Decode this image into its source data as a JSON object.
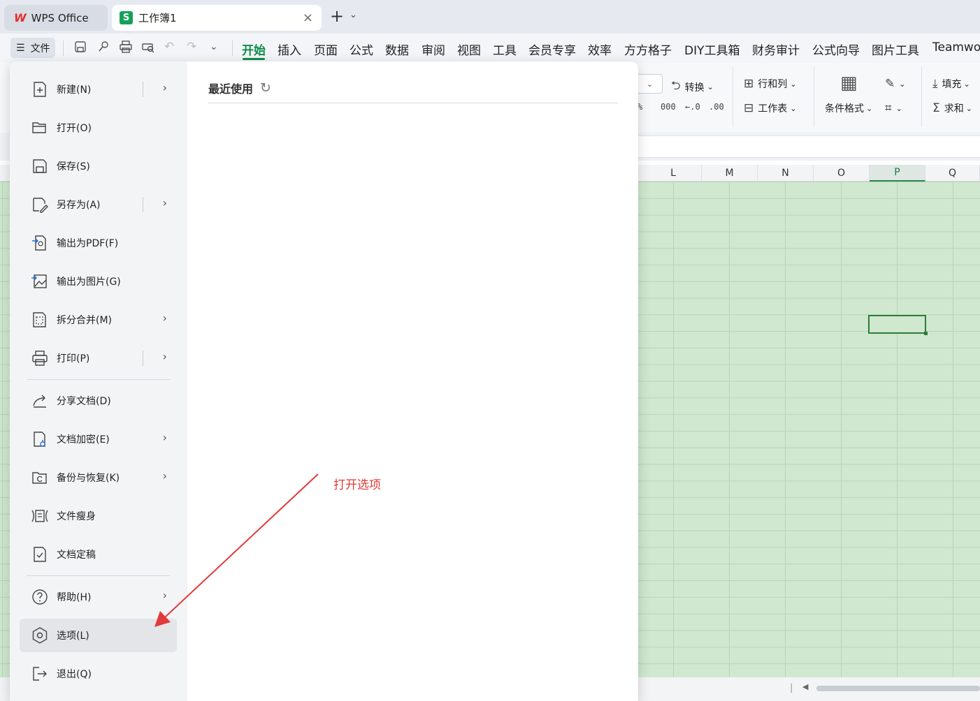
{
  "tabs": {
    "wps_label": "WPS Office",
    "workbook_label": "工作簿1",
    "new_tab_label": "+",
    "close_label": "×"
  },
  "ribbon": {
    "file_label": "文件",
    "tabs": [
      "开始",
      "插入",
      "页面",
      "公式",
      "数据",
      "审阅",
      "视图",
      "工具",
      "会员专享",
      "效率",
      "方方格子",
      "DIY工具箱",
      "财务审计",
      "公式向导",
      "图片工具",
      "Teamwo"
    ],
    "active_tab": "开始",
    "tools": {
      "convert": "转换",
      "row_col": "行和列",
      "worksheet": "工作表",
      "cond_format": "条件格式",
      "fill": "填充",
      "sum": "求和"
    }
  },
  "sheet": {
    "columns": [
      "L",
      "M",
      "N",
      "O",
      "P",
      "Q"
    ],
    "selected_column": "P"
  },
  "file_menu": {
    "items": [
      {
        "label": "新建(N)",
        "icon": "new-file-icon",
        "submenu": true
      },
      {
        "label": "打开(O)",
        "icon": "open-folder-icon",
        "submenu": false
      },
      {
        "label": "保存(S)",
        "icon": "save-icon",
        "submenu": false
      },
      {
        "label": "另存为(A)",
        "icon": "save-as-icon",
        "submenu": true
      },
      {
        "label": "输出为PDF(F)",
        "icon": "export-pdf-icon",
        "submenu": false
      },
      {
        "label": "输出为图片(G)",
        "icon": "export-image-icon",
        "submenu": false
      },
      {
        "label": "拆分合并(M)",
        "icon": "split-merge-icon",
        "submenu": true
      },
      {
        "label": "打印(P)",
        "icon": "print-icon",
        "submenu": true
      },
      {
        "label": "分享文档(D)",
        "icon": "share-icon",
        "submenu": false
      },
      {
        "label": "文档加密(E)",
        "icon": "encrypt-icon",
        "submenu": true
      },
      {
        "label": "备份与恢复(K)",
        "icon": "backup-icon",
        "submenu": true
      },
      {
        "label": "文件瘦身",
        "icon": "slim-icon",
        "submenu": false
      },
      {
        "label": "文档定稿",
        "icon": "finalize-icon",
        "submenu": false
      },
      {
        "label": "帮助(H)",
        "icon": "help-icon",
        "submenu": true
      },
      {
        "label": "选项(L)",
        "icon": "options-icon",
        "submenu": false
      },
      {
        "label": "退出(Q)",
        "icon": "exit-icon",
        "submenu": false
      }
    ],
    "recent_title": "最近使用"
  },
  "annotation": {
    "text": "打开选项",
    "color": "#e23a3a"
  },
  "colors": {
    "accent": "#0f8a4a",
    "grid_fill": "#cfe8cf",
    "active_cell_border": "#2d7d35"
  }
}
